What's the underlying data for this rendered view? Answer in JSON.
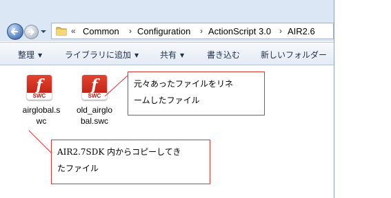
{
  "address_bar": {
    "history_marker": "«",
    "crumbs": [
      "Common",
      "Configuration",
      "ActionScript 3.0",
      "AIR2.6"
    ],
    "separator": "›"
  },
  "toolbar": {
    "items": [
      {
        "label": "整理",
        "has_dropdown": true
      },
      {
        "label": "ライブラリに追加",
        "has_dropdown": true
      },
      {
        "label": "共有",
        "has_dropdown": true
      },
      {
        "label": "書き込む",
        "has_dropdown": false
      },
      {
        "label": "新しいフォルダー",
        "has_dropdown": false
      }
    ]
  },
  "files": [
    {
      "name_line1": "airglobal.s",
      "name_line2": "wc",
      "icon": "flash-swc-icon",
      "icon_label": "SWC",
      "icon_glyph": "f"
    },
    {
      "name_line1": "old_airglo",
      "name_line2": "bal.swc",
      "icon": "flash-swc-icon",
      "icon_label": "SWC",
      "icon_glyph": "f"
    }
  ],
  "callouts": {
    "renamed": {
      "line1": "元々あったファイルをリネ",
      "line2": "ームしたファイル"
    },
    "copied": {
      "line1": "AIR2.7SDK 内からコピーしてき",
      "line2": "たファイル"
    }
  },
  "colors": {
    "callout_border": "#e03030",
    "icon_red": "#c3261a",
    "nav_bg": "#dce7f5"
  }
}
